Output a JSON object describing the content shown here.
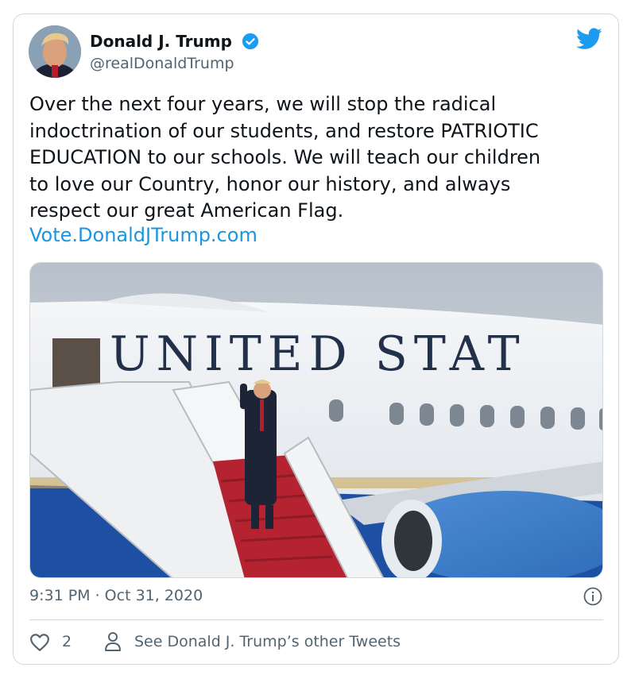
{
  "author": {
    "name": "Donald J. Trump",
    "handle": "@realDonaldTrump"
  },
  "tweet": {
    "text": "Over the next four years, we will stop the radical\nindoctrination of our students, and restore PATRIOTIC\nEDUCATION to our schools. We will teach our children\nto love our Country, honor our history, and always\nrespect our great American Flag.",
    "link": "Vote.DonaldJTrump.com",
    "timestamp": "9:31 PM · Oct 31, 2020"
  },
  "media": {
    "plane_lettering": "UNITED STAT"
  },
  "footer": {
    "likes_count": "2",
    "other_tweets_label": "See Donald J. Trump’s other Tweets"
  },
  "colors": {
    "link": "#1b95e0",
    "verified": "#1d9bf0",
    "text_secondary": "#536471"
  },
  "icons": [
    "verified-badge-icon",
    "twitter-bird-icon",
    "info-icon",
    "heart-icon",
    "person-icon"
  ]
}
